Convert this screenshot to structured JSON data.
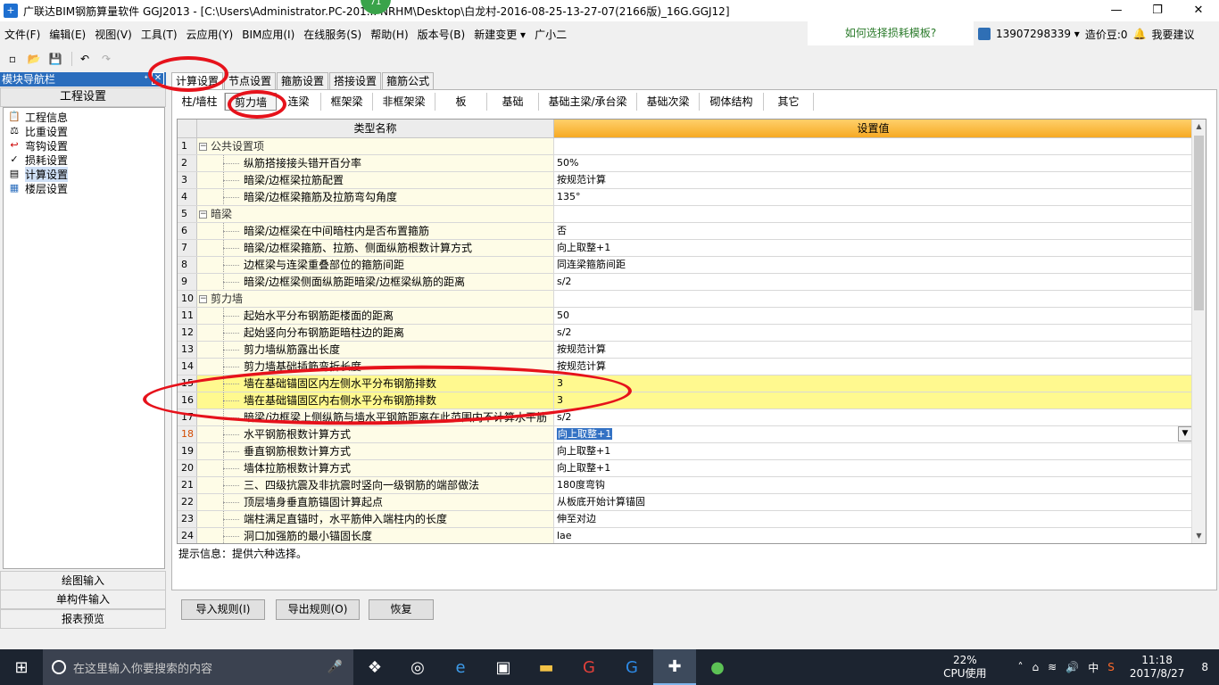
{
  "window": {
    "title": "广联达BIM钢筋算量软件 GGJ2013 - [C:\\Users\\Administrator.PC-201... NRHM\\Desktop\\白龙村-2016-08-25-13-27-07(2166版)_16G.GGJ12]",
    "badge": "71",
    "controls": {
      "minimize": "—",
      "restore": "❐",
      "close": "✕"
    }
  },
  "menubar": {
    "items": [
      "文件(F)",
      "编辑(E)",
      "视图(V)",
      "工具(T)",
      "云应用(Y)",
      "BIM应用(I)",
      "在线服务(S)",
      "帮助(H)",
      "版本号(B)",
      "新建变更 ▾",
      "广小二"
    ],
    "help_link": "如何选择损耗模板?",
    "phone": "13907298339 ▾",
    "beans": "造价豆:0",
    "suggest": "我要建议"
  },
  "nav": {
    "header": "模块导航栏",
    "pin": "ᐩ",
    "close": "✕",
    "section": "工程设置",
    "items": [
      {
        "label": "工程信息",
        "icon": "📋"
      },
      {
        "label": "比重设置",
        "icon": "⚖"
      },
      {
        "label": "弯钩设置",
        "icon": "↩"
      },
      {
        "label": "损耗设置",
        "icon": "✓"
      },
      {
        "label": "计算设置",
        "icon": "▤"
      },
      {
        "label": "楼层设置",
        "icon": "▦"
      }
    ],
    "bottom": [
      "绘图输入",
      "单构件输入",
      "报表预览"
    ]
  },
  "top_tabs": [
    "计算设置",
    "节点设置",
    "箍筋设置",
    "搭接设置",
    "箍筋公式"
  ],
  "sub_tabs": [
    "柱/墙柱",
    "剪力墙",
    "连梁",
    "框架梁",
    "非框架梁",
    "板",
    "基础",
    "基础主梁/承台梁",
    "基础次梁",
    "砌体结构",
    "其它"
  ],
  "grid": {
    "col_name": "类型名称",
    "col_value": "设置值",
    "rows": [
      {
        "n": "1",
        "name": "公共设置项",
        "value": "",
        "type": "group"
      },
      {
        "n": "2",
        "name": "纵筋搭接接头错开百分率",
        "value": "50%",
        "type": "item"
      },
      {
        "n": "3",
        "name": "暗梁/边框梁拉筋配置",
        "value": "按规范计算",
        "type": "item"
      },
      {
        "n": "4",
        "name": "暗梁/边框梁箍筋及拉筋弯勾角度",
        "value": "135°",
        "type": "item"
      },
      {
        "n": "5",
        "name": "暗梁",
        "value": "",
        "type": "group"
      },
      {
        "n": "6",
        "name": "暗梁/边框梁在中间暗柱内是否布置箍筋",
        "value": "否",
        "type": "item"
      },
      {
        "n": "7",
        "name": "暗梁/边框梁箍筋、拉筋、侧面纵筋根数计算方式",
        "value": "向上取整+1",
        "type": "item"
      },
      {
        "n": "8",
        "name": "边框梁与连梁重叠部位的箍筋间距",
        "value": "同连梁箍筋间距",
        "type": "item"
      },
      {
        "n": "9",
        "name": "暗梁/边框梁侧面纵筋距暗梁/边框梁纵筋的距离",
        "value": "s/2",
        "type": "item"
      },
      {
        "n": "10",
        "name": "剪力墙",
        "value": "",
        "type": "group"
      },
      {
        "n": "11",
        "name": "起始水平分布钢筋距楼面的距离",
        "value": "50",
        "type": "item"
      },
      {
        "n": "12",
        "name": "起始竖向分布钢筋距暗柱边的距离",
        "value": "s/2",
        "type": "item"
      },
      {
        "n": "13",
        "name": "剪力墙纵筋露出长度",
        "value": "按规范计算",
        "type": "item"
      },
      {
        "n": "14",
        "name": "剪力墙基础插筋弯折长度",
        "value": "按规范计算",
        "type": "item"
      },
      {
        "n": "15",
        "name": "墙在基础锚固区内左侧水平分布钢筋排数",
        "value": "3",
        "type": "item",
        "hl": true
      },
      {
        "n": "16",
        "name": "墙在基础锚固区内右侧水平分布钢筋排数",
        "value": "3",
        "type": "item",
        "hl": true
      },
      {
        "n": "17",
        "name": "暗梁/边框梁上侧纵筋与墙水平钢筋距离在此范围内不计算水平筋",
        "value": "s/2",
        "type": "item"
      },
      {
        "n": "18",
        "name": "水平钢筋根数计算方式",
        "value": "向上取整+1",
        "type": "item",
        "current": true
      },
      {
        "n": "19",
        "name": "垂直钢筋根数计算方式",
        "value": "向上取整+1",
        "type": "item"
      },
      {
        "n": "20",
        "name": "墙体拉筋根数计算方式",
        "value": "向上取整+1",
        "type": "item"
      },
      {
        "n": "21",
        "name": "三、四级抗震及非抗震时竖向一级钢筋的端部做法",
        "value": "180度弯钩",
        "type": "item"
      },
      {
        "n": "22",
        "name": "顶层墙身垂直筋锚固计算起点",
        "value": "从板底开始计算锚固",
        "type": "item"
      },
      {
        "n": "23",
        "name": "端柱满足直锚时，水平筋伸入端柱内的长度",
        "value": "伸至对边",
        "type": "item"
      },
      {
        "n": "24",
        "name": "洞口加强筋的最小锚固长度",
        "value": "lae",
        "type": "item"
      }
    ]
  },
  "hint": "提示信息：提供六种选择。",
  "buttons": {
    "import": "导入规则(I)",
    "export": "导出规则(O)",
    "restore": "恢复"
  },
  "taskbar": {
    "search_placeholder": "在这里输入你要搜索的内容",
    "cpu_pct": "22%",
    "cpu_label": "CPU使用",
    "ime": "中",
    "time": "11:18",
    "date": "2017/8/27",
    "notif": "8"
  },
  "colors": {
    "accent": "#2a6dbd",
    "highlight_row": "#fff98f",
    "annotation": "#e6121b",
    "header_value": "#f6a923"
  }
}
